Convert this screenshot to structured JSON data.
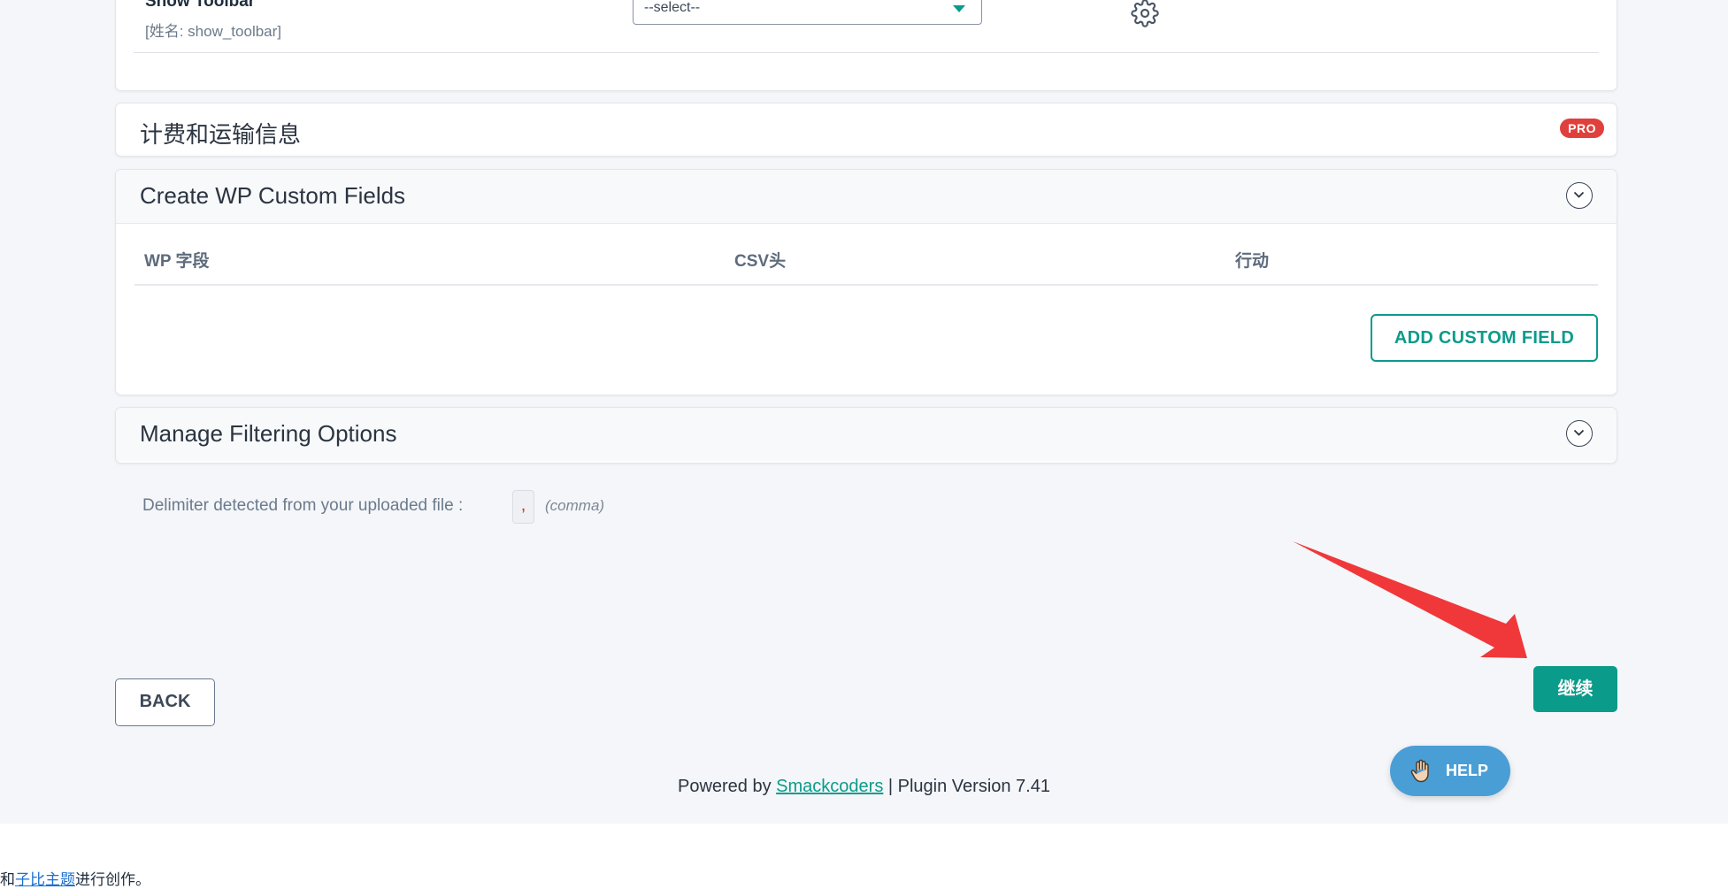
{
  "show_toolbar": {
    "label": "Show Toolbar",
    "sub_label": "[姓名: show_toolbar]",
    "select_value": "--select--",
    "settings_icon": "gear-icon"
  },
  "billing": {
    "title": "计费和运输信息",
    "badge": "PRO"
  },
  "custom_fields": {
    "title": "Create WP Custom Fields",
    "columns": [
      "WP 字段",
      "CSV头",
      "行动"
    ],
    "add_button": "ADD CUSTOM FIELD",
    "toggle_icon": "chevron-down-icon"
  },
  "filtering": {
    "title": "Manage Filtering Options",
    "toggle_icon": "chevron-down-icon"
  },
  "delimiter": {
    "label": "Delimiter detected from your uploaded file :",
    "value": ",",
    "name": "(comma)"
  },
  "actions": {
    "back": "BACK",
    "continue": "继续",
    "help": "HELP",
    "help_icon": "hand-icon"
  },
  "footer": {
    "prefix": "Powered by",
    "link": "Smackcoders",
    "suffix": "| Plugin Version 7.41"
  },
  "page_footer": {
    "prefix": "和",
    "link": "子比主题",
    "suffix": "进行创作。"
  },
  "colors": {
    "accent": "#0b9b8a",
    "pro_badge": "#e0403c",
    "help": "#4a9ed6",
    "annotation_arrow": "#f0383a"
  }
}
